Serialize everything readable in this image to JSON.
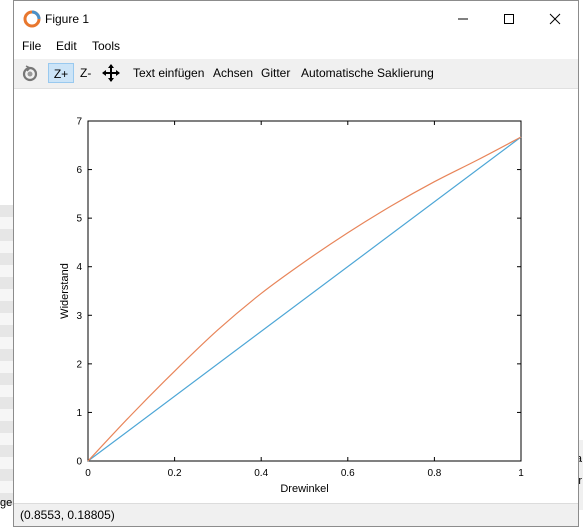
{
  "window": {
    "title": "Figure 1",
    "controls": {
      "minimize": "—",
      "maximize": "☐",
      "close": "✕"
    }
  },
  "menu": [
    "File",
    "Edit",
    "Tools"
  ],
  "toolbar": {
    "icon_rotate": "rotate-icon",
    "zoom_in": "Z+",
    "zoom_out": "Z-",
    "icon_pan": "pan-icon",
    "insert_text": "Text einfügen",
    "axes": "Achsen",
    "grid": "Gitter",
    "autoscale": "Automatische Saklierung"
  },
  "status": {
    "coords": "(0.8553, 0.18805)"
  },
  "background": {
    "frag_left": "ge",
    "frag_right_top": "a",
    "frag_right_bottom": "r"
  },
  "colors": {
    "series1": "#4da6d6",
    "series2": "#e8855a",
    "active_tool": "#cce4f7"
  },
  "chart_data": {
    "type": "line",
    "title": "",
    "xlabel": "Drewinkel",
    "ylabel": "Widerstand",
    "xlim": [
      0,
      1
    ],
    "ylim": [
      0,
      7
    ],
    "xticks": [
      "0",
      "0.2",
      "0.4",
      "0.6",
      "0.8",
      "1"
    ],
    "yticks": [
      "0",
      "1",
      "2",
      "3",
      "4",
      "5",
      "6",
      "7"
    ],
    "grid": false,
    "series": [
      {
        "color": "#4da6d6",
        "x": [
          0,
          1
        ],
        "y": [
          0,
          6.67
        ]
      },
      {
        "color": "#e8855a",
        "x": [
          0,
          0.1,
          0.2,
          0.3,
          0.4,
          0.5,
          0.6,
          0.7,
          0.8,
          0.9,
          1
        ],
        "y": [
          0,
          0.95,
          1.85,
          2.7,
          3.45,
          4.1,
          4.7,
          5.25,
          5.75,
          6.2,
          6.67
        ]
      }
    ]
  }
}
